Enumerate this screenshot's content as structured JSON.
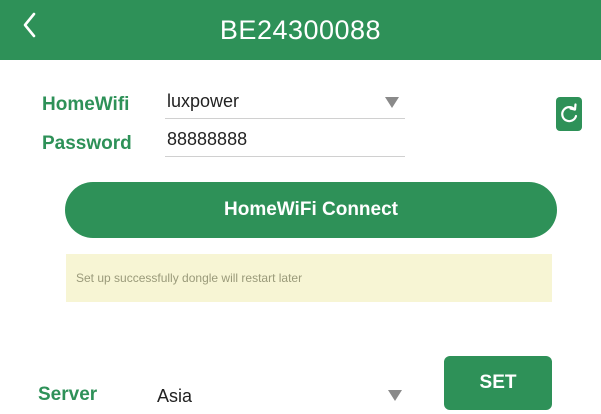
{
  "header": {
    "title": "BE24300088",
    "back_icon": "chevron-left-icon"
  },
  "wifi": {
    "home_wifi_label": "HomeWifi",
    "home_wifi_value": "luxpower",
    "password_label": "Password",
    "password_value": "88888888",
    "refresh_icon": "refresh-icon"
  },
  "connect_button_label": "HomeWiFi Connect",
  "status_message": "Set up successfully dongle will restart later",
  "server": {
    "label": "Server",
    "value": "Asia",
    "set_button_label": "SET"
  },
  "colors": {
    "accent": "#2e9158",
    "status_background": "#f7f5d4"
  }
}
